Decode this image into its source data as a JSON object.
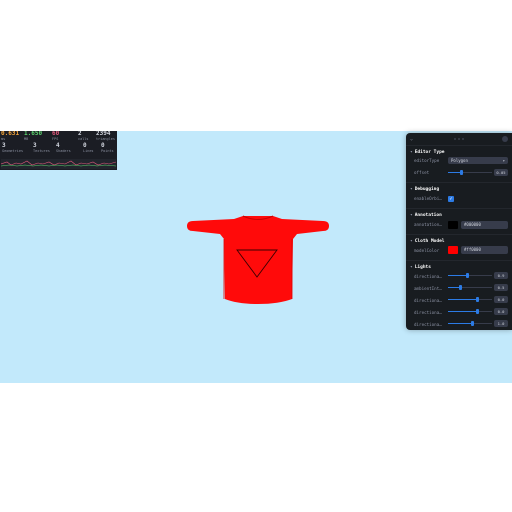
{
  "stats": {
    "metrics": [
      {
        "value": "0.631",
        "label": "ms",
        "color": "#f2a33a"
      },
      {
        "value": "1.650",
        "label": "MB",
        "color": "#5bd16e"
      },
      {
        "value": "60",
        "label": "FPS",
        "color": "#e05a7d"
      },
      {
        "value": "2",
        "label": "calls",
        "color": "#cfd3dc"
      },
      {
        "value": "2394",
        "label": "triangles",
        "color": "#cfd3dc"
      }
    ],
    "counts": [
      {
        "value": "3",
        "label": "Geometries"
      },
      {
        "value": "3",
        "label": "Textures"
      },
      {
        "value": "4",
        "label": "Shaders"
      },
      {
        "value": "0",
        "label": "Lines"
      },
      {
        "value": "0",
        "label": "Points"
      }
    ]
  },
  "model": {
    "shirt_color": "#ff0000",
    "icon": "triangle-down-icon"
  },
  "panel": {
    "folders": {
      "editor_type": "Editor Type",
      "debugging": "Debugging",
      "annotation": "Annotation",
      "cloth_model": "Cloth Model",
      "lights": "Lights"
    },
    "editor_type": {
      "mode_label": "editorType",
      "mode_value": "Polygon",
      "offset_label": "offset",
      "offset_value": "0.05",
      "offset_fraction": 0.3
    },
    "debugging": {
      "wireframe_label": "enableOrbi…",
      "wireframe_checked": true
    },
    "annotation": {
      "color_label": "annotation…",
      "color_value": "#000000"
    },
    "cloth_model": {
      "color_label": "modelColor",
      "color_value": "#ff0000"
    },
    "lights": [
      {
        "label": "directiona…",
        "value": "0.9",
        "fraction": 0.45
      },
      {
        "label": "ambientInt…",
        "value": "0.5",
        "fraction": 0.28
      },
      {
        "label": "directiona…",
        "value": "0.0",
        "fraction": 0.68
      },
      {
        "label": "directiona…",
        "value": "0.0",
        "fraction": 0.68
      },
      {
        "label": "directiona…",
        "value": "1.0",
        "fraction": 0.55
      }
    ]
  }
}
